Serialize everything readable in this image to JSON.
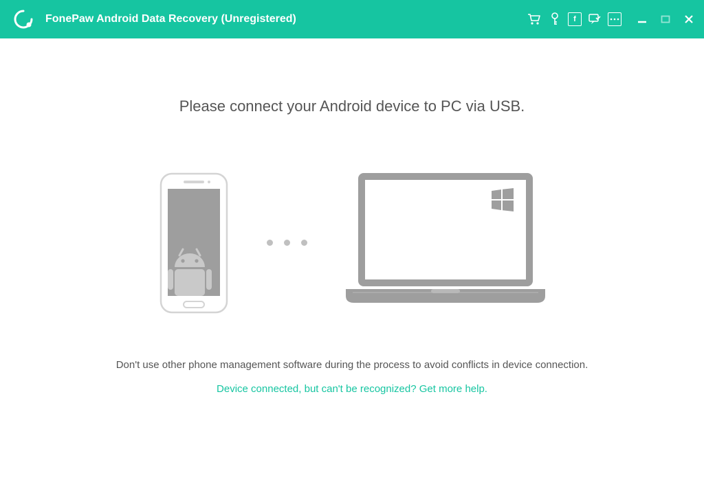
{
  "titlebar": {
    "app_title": "FonePaw Android Data Recovery (Unregistered)",
    "icons": {
      "cart": "cart-icon",
      "key": "key-icon",
      "facebook": "facebook-icon",
      "feedback": "feedback-icon",
      "more": "more-icon"
    }
  },
  "content": {
    "instruction": "Please connect your Android device to PC via USB.",
    "warning": "Don't use other phone management software during the process to avoid conflicts in device connection.",
    "help_link": "Device connected, but can't be recognized? Get more help."
  },
  "colors": {
    "accent": "#16c5a1",
    "text_primary": "#555555",
    "illustration_gray": "#999999",
    "illustration_light": "#d4d4d4"
  }
}
